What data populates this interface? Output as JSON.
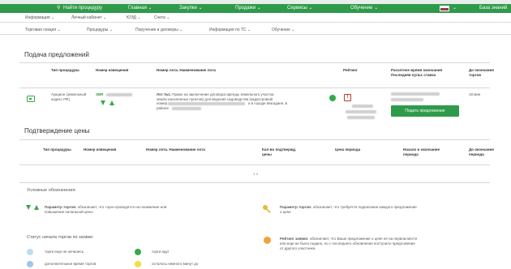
{
  "header": {
    "search": "Найти процедуру",
    "nav": [
      "Главная",
      "Закупки",
      "Продажи",
      "Сервисы",
      "Обучение"
    ],
    "kb": "База знаний"
  },
  "subnav1": [
    "Информация",
    "Личный кабинет",
    "ЮЭД",
    "Счета"
  ],
  "subnav2": [
    "Торговая секция",
    "Процедуры",
    "Поручения и договоры",
    "Информация по ТС",
    "Обучение"
  ],
  "submission": {
    "title": "Подача предложений",
    "headers": {
      "type": "Тип процедуры",
      "notice": "Номер извещения",
      "lot": "Номер лота. Наименование лота",
      "rating": "Рейтинг",
      "deadline": "Расчетное время окончания Последняя пульс ставка",
      "until": "До окончания торгов"
    },
    "row": {
      "type": "Аукцион (земельный кодекс РФ)",
      "notice_prefix": "SBR",
      "lot_label": "Лот №1.",
      "lot_text_1": "Право на заключение договора аренды земельного участка",
      "lot_text_2": "земли населенных пунктов) для ведения садоводства (кадастровый",
      "lot_text_3": "номер",
      "lot_text_4": "и в городе Магадане, в",
      "lot_text_5": "районе",
      "warn_mark": "!",
      "button": "Подать предложение",
      "until": "18 мин"
    }
  },
  "confirmation": {
    "title": "Подтверждение цены",
    "headers": {
      "type": "Тип процедуры",
      "notice": "Номер извещения",
      "lot": "Номер лота. Наименование лота",
      "count": "Кол-во подтвержд. цены",
      "price": "Цена периода",
      "period": "Начало и окончание периода",
      "until": "До окончания периода"
    },
    "pager": "1 1"
  },
  "legend": {
    "title": "Условные обозначения:",
    "items": {
      "direction_label": "Параметр торгов:",
      "direction_text_1": "обозначает, что торги проводятся на понижение или",
      "direction_text_2": "повышение начальной цены",
      "key_label": "Параметр торгов:",
      "key_text_1": "обозначает, что требуется подписание каждого предложения",
      "key_text_2": "о цене",
      "rating_label": "Рейтинг заявки:",
      "rating_text_1": "обозначает, что Ваше предложение о цене не на первом месте",
      "rating_text_2": "или еще не было подано, но с последнего обновления поступило предложение",
      "rating_text_3": "от другого участника"
    },
    "status_title": "Статус начала торгов по заявке:",
    "status": [
      {
        "text": "торги еще не начались",
        "color": "#b7e0ef"
      },
      {
        "text": "торги идут",
        "color": "#37a84b"
      },
      {
        "text": "дополнительное время торгов",
        "color": "#9fc6e6"
      },
      {
        "text": "осталось немного минут до",
        "color": "#f2de42"
      }
    ]
  },
  "colors": {
    "brand": "#2e9a4a",
    "green": "#37a84b",
    "orange": "#f0a23a",
    "red": "#c0392b",
    "key_gold": "#e6b93c"
  }
}
